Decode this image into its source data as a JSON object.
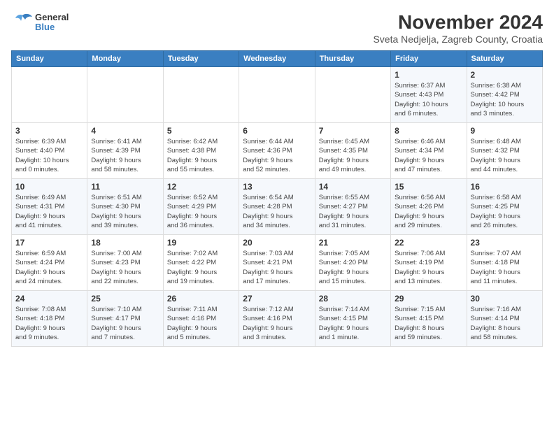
{
  "header": {
    "logo_line1": "General",
    "logo_line2": "Blue",
    "title": "November 2024",
    "subtitle": "Sveta Nedjelja, Zagreb County, Croatia"
  },
  "weekdays": [
    "Sunday",
    "Monday",
    "Tuesday",
    "Wednesday",
    "Thursday",
    "Friday",
    "Saturday"
  ],
  "weeks": [
    [
      {
        "day": "",
        "info": ""
      },
      {
        "day": "",
        "info": ""
      },
      {
        "day": "",
        "info": ""
      },
      {
        "day": "",
        "info": ""
      },
      {
        "day": "",
        "info": ""
      },
      {
        "day": "1",
        "info": "Sunrise: 6:37 AM\nSunset: 4:43 PM\nDaylight: 10 hours\nand 6 minutes."
      },
      {
        "day": "2",
        "info": "Sunrise: 6:38 AM\nSunset: 4:42 PM\nDaylight: 10 hours\nand 3 minutes."
      }
    ],
    [
      {
        "day": "3",
        "info": "Sunrise: 6:39 AM\nSunset: 4:40 PM\nDaylight: 10 hours\nand 0 minutes."
      },
      {
        "day": "4",
        "info": "Sunrise: 6:41 AM\nSunset: 4:39 PM\nDaylight: 9 hours\nand 58 minutes."
      },
      {
        "day": "5",
        "info": "Sunrise: 6:42 AM\nSunset: 4:38 PM\nDaylight: 9 hours\nand 55 minutes."
      },
      {
        "day": "6",
        "info": "Sunrise: 6:44 AM\nSunset: 4:36 PM\nDaylight: 9 hours\nand 52 minutes."
      },
      {
        "day": "7",
        "info": "Sunrise: 6:45 AM\nSunset: 4:35 PM\nDaylight: 9 hours\nand 49 minutes."
      },
      {
        "day": "8",
        "info": "Sunrise: 6:46 AM\nSunset: 4:34 PM\nDaylight: 9 hours\nand 47 minutes."
      },
      {
        "day": "9",
        "info": "Sunrise: 6:48 AM\nSunset: 4:32 PM\nDaylight: 9 hours\nand 44 minutes."
      }
    ],
    [
      {
        "day": "10",
        "info": "Sunrise: 6:49 AM\nSunset: 4:31 PM\nDaylight: 9 hours\nand 41 minutes."
      },
      {
        "day": "11",
        "info": "Sunrise: 6:51 AM\nSunset: 4:30 PM\nDaylight: 9 hours\nand 39 minutes."
      },
      {
        "day": "12",
        "info": "Sunrise: 6:52 AM\nSunset: 4:29 PM\nDaylight: 9 hours\nand 36 minutes."
      },
      {
        "day": "13",
        "info": "Sunrise: 6:54 AM\nSunset: 4:28 PM\nDaylight: 9 hours\nand 34 minutes."
      },
      {
        "day": "14",
        "info": "Sunrise: 6:55 AM\nSunset: 4:27 PM\nDaylight: 9 hours\nand 31 minutes."
      },
      {
        "day": "15",
        "info": "Sunrise: 6:56 AM\nSunset: 4:26 PM\nDaylight: 9 hours\nand 29 minutes."
      },
      {
        "day": "16",
        "info": "Sunrise: 6:58 AM\nSunset: 4:25 PM\nDaylight: 9 hours\nand 26 minutes."
      }
    ],
    [
      {
        "day": "17",
        "info": "Sunrise: 6:59 AM\nSunset: 4:24 PM\nDaylight: 9 hours\nand 24 minutes."
      },
      {
        "day": "18",
        "info": "Sunrise: 7:00 AM\nSunset: 4:23 PM\nDaylight: 9 hours\nand 22 minutes."
      },
      {
        "day": "19",
        "info": "Sunrise: 7:02 AM\nSunset: 4:22 PM\nDaylight: 9 hours\nand 19 minutes."
      },
      {
        "day": "20",
        "info": "Sunrise: 7:03 AM\nSunset: 4:21 PM\nDaylight: 9 hours\nand 17 minutes."
      },
      {
        "day": "21",
        "info": "Sunrise: 7:05 AM\nSunset: 4:20 PM\nDaylight: 9 hours\nand 15 minutes."
      },
      {
        "day": "22",
        "info": "Sunrise: 7:06 AM\nSunset: 4:19 PM\nDaylight: 9 hours\nand 13 minutes."
      },
      {
        "day": "23",
        "info": "Sunrise: 7:07 AM\nSunset: 4:18 PM\nDaylight: 9 hours\nand 11 minutes."
      }
    ],
    [
      {
        "day": "24",
        "info": "Sunrise: 7:08 AM\nSunset: 4:18 PM\nDaylight: 9 hours\nand 9 minutes."
      },
      {
        "day": "25",
        "info": "Sunrise: 7:10 AM\nSunset: 4:17 PM\nDaylight: 9 hours\nand 7 minutes."
      },
      {
        "day": "26",
        "info": "Sunrise: 7:11 AM\nSunset: 4:16 PM\nDaylight: 9 hours\nand 5 minutes."
      },
      {
        "day": "27",
        "info": "Sunrise: 7:12 AM\nSunset: 4:16 PM\nDaylight: 9 hours\nand 3 minutes."
      },
      {
        "day": "28",
        "info": "Sunrise: 7:14 AM\nSunset: 4:15 PM\nDaylight: 9 hours\nand 1 minute."
      },
      {
        "day": "29",
        "info": "Sunrise: 7:15 AM\nSunset: 4:15 PM\nDaylight: 8 hours\nand 59 minutes."
      },
      {
        "day": "30",
        "info": "Sunrise: 7:16 AM\nSunset: 4:14 PM\nDaylight: 8 hours\nand 58 minutes."
      }
    ]
  ]
}
